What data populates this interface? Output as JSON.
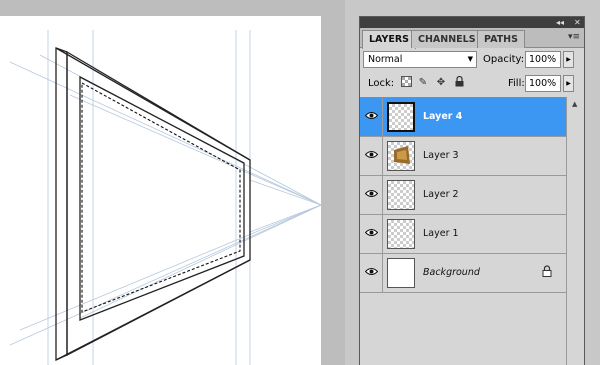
{
  "panel": {
    "topbar": {
      "collapse_glyph": "◂◂",
      "close_glyph": "✕"
    },
    "tabs": [
      {
        "label": "LAYERS",
        "active": true
      },
      {
        "label": "CHANNELS",
        "active": false
      },
      {
        "label": "PATHS",
        "active": false
      }
    ],
    "menu_glyph": "▾≡",
    "blend_mode": "Normal",
    "opacity_label": "Opacity:",
    "opacity_value": "100%",
    "lock_label": "Lock:",
    "fill_label": "Fill:",
    "fill_value": "100%",
    "lock_icons": [
      "lock-transparent-icon",
      "lock-image-icon",
      "lock-position-icon",
      "lock-all-icon"
    ],
    "selected_color": "#3b97f2"
  },
  "layers": [
    {
      "name": "Layer 4",
      "selected": true,
      "thumb": "transparent",
      "locked": false
    },
    {
      "name": "Layer 3",
      "selected": false,
      "thumb": "content",
      "locked": false
    },
    {
      "name": "Layer 2",
      "selected": false,
      "thumb": "transparent",
      "locked": false
    },
    {
      "name": "Layer 1",
      "selected": false,
      "thumb": "transparent",
      "locked": false
    },
    {
      "name": "Background",
      "selected": false,
      "thumb": "white",
      "locked": true
    }
  ]
}
